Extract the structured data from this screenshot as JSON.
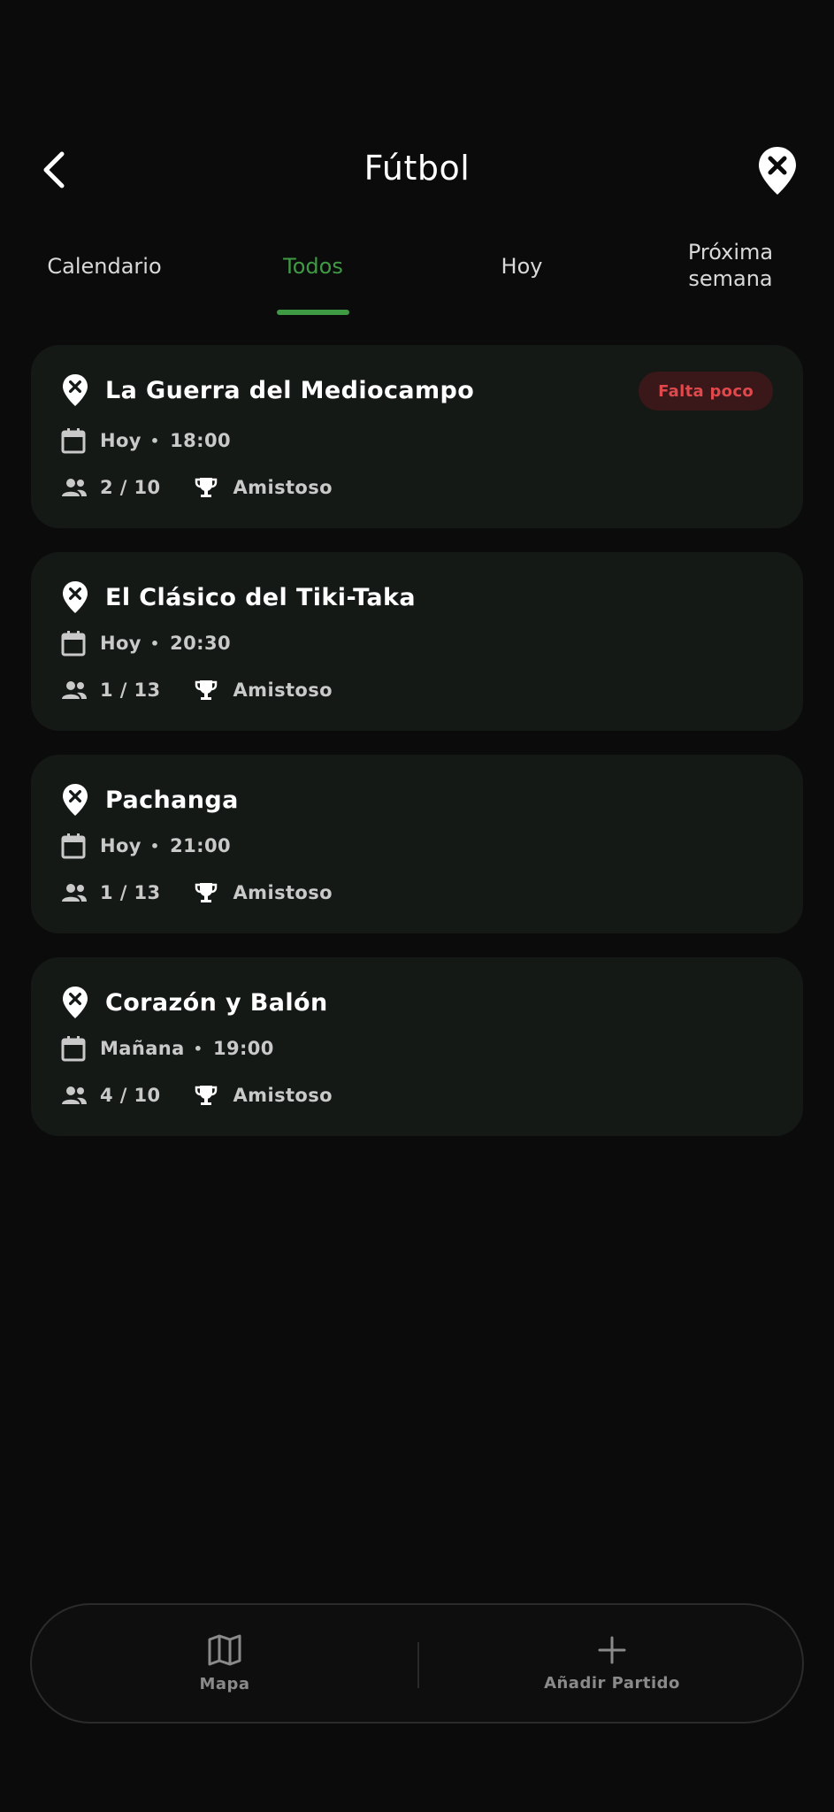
{
  "header": {
    "title": "Fútbol"
  },
  "tabs": [
    {
      "label": "Calendario"
    },
    {
      "label": "Todos"
    },
    {
      "label": "Hoy"
    },
    {
      "label_line1": "Próxima",
      "label_line2": "semana"
    }
  ],
  "active_tab": "Todos",
  "colors": {
    "accent": "#3f9a44",
    "badge_text": "#e0484c",
    "badge_bg": "#3a1718",
    "card_bg": "#151916"
  },
  "matches": [
    {
      "name": "La Guerra del Mediocampo",
      "day": "Hoy",
      "time": "18:00",
      "players": "2 / 10",
      "type": "Amistoso",
      "badge": "Falta poco"
    },
    {
      "name": "El Clásico del Tiki-Taka",
      "day": "Hoy",
      "time": "20:30",
      "players": "1 / 13",
      "type": "Amistoso"
    },
    {
      "name": "Pachanga",
      "day": "Hoy",
      "time": "21:00",
      "players": "1 / 13",
      "type": "Amistoso"
    },
    {
      "name": "Corazón y Balón",
      "day": "Mañana",
      "time": "19:00",
      "players": "4 / 10",
      "type": "Amistoso"
    }
  ],
  "icons": {
    "back": "chevron-left-icon",
    "location": "location-pin-x-icon",
    "calendar": "calendar-icon",
    "players": "group-icon",
    "competition": "trophy-icon",
    "map": "map-icon",
    "add": "plus-icon"
  },
  "bottom_bar": {
    "map_label": "Mapa",
    "add_label": "Añadir Partido"
  }
}
